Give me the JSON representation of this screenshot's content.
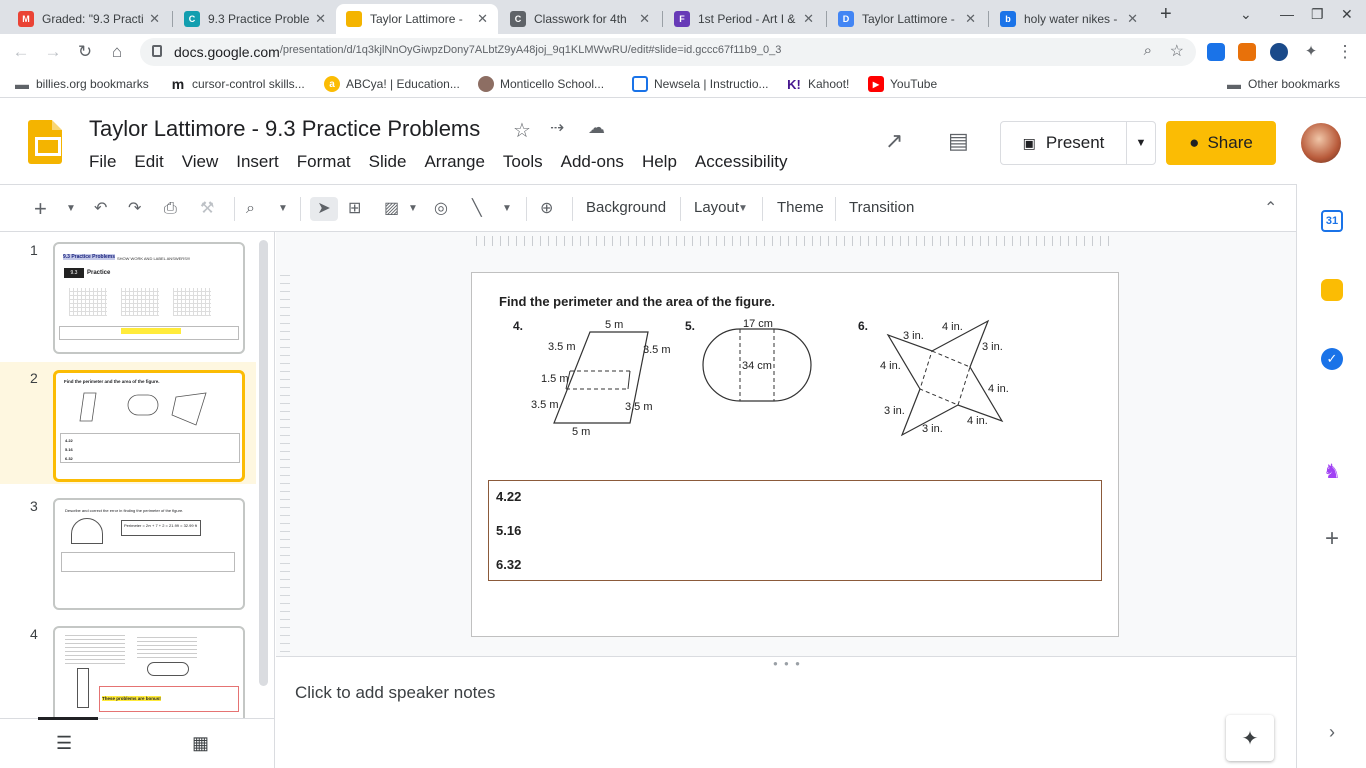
{
  "browser": {
    "tabs": [
      {
        "title": "Graded: \"9.3 Practice",
        "fav_color": "#ea4335",
        "fav_text": "M"
      },
      {
        "title": "9.3 Practice Proble",
        "fav_color": "#129eaf",
        "fav_text": "C"
      },
      {
        "title": "Taylor Lattimore -",
        "fav_color": "#f4b400",
        "fav_text": ""
      },
      {
        "title": "Classwork for 4th",
        "fav_color": "#5f6368",
        "fav_text": "C"
      },
      {
        "title": "1st Period - Art I &",
        "fav_color": "#673ab7",
        "fav_text": "F"
      },
      {
        "title": "Taylor Lattimore -",
        "fav_color": "#4285f4",
        "fav_text": "D"
      },
      {
        "title": "holy water nikes -",
        "fav_color": "#1a73e8",
        "fav_text": "b"
      }
    ],
    "url_host": "docs.google.com",
    "url_path": "/presentation/d/1q3kjlNnOyGiwpzDony7ALbtZ9yA48joj_9q1KLMWwRU/edit#slide=id.gccc67f11b9_0_3",
    "bookmarks": [
      {
        "label": "billies.org bookmarks",
        "icon": "folder-icon"
      },
      {
        "label": "cursor-control skills...",
        "icon": "m-logo-icon"
      },
      {
        "label": "ABCya! | Education...",
        "icon": "abcya-icon"
      },
      {
        "label": "Monticello School...",
        "icon": "school-icon"
      },
      {
        "label": "Newsela | Instructio...",
        "icon": "newsela-icon"
      },
      {
        "label": "Kahoot!",
        "icon": "kahoot-icon"
      },
      {
        "label": "YouTube",
        "icon": "youtube-icon"
      }
    ],
    "other_bookmarks": "Other bookmarks"
  },
  "app": {
    "doc_title": "Taylor Lattimore - 9.3 Practice Problems",
    "menu": [
      "File",
      "Edit",
      "View",
      "Insert",
      "Format",
      "Slide",
      "Arrange",
      "Tools",
      "Add-ons",
      "Help",
      "Accessibility"
    ],
    "present_label": "Present",
    "share_label": "Share",
    "toolbar": {
      "background": "Background",
      "layout": "Layout",
      "theme": "Theme",
      "transition": "Transition"
    },
    "brand_color": "#fbbc04"
  },
  "filmstrip": {
    "slides": [
      {
        "num": "1",
        "title": "9.3 Practice Problems",
        "note": "SHOW WORK AND LABEL ANSWERS!!!",
        "badge": "9.3",
        "sub": "Practice"
      },
      {
        "num": "2",
        "title": "Find the perimeter and the area of the figure.",
        "answers": [
          "4.22",
          "5.16",
          "6.32"
        ]
      },
      {
        "num": "3",
        "title": "Describe and correct the error in finding the perimeter of the figure.",
        "formula": "Perimeter = 2π + 7 + 2 = 21.99 = 32.99 ft"
      },
      {
        "num": "4",
        "title": "",
        "highlight": "These problems are bonus!"
      }
    ]
  },
  "slide": {
    "heading": "Find the perimeter and the area of the figure.",
    "figures": [
      {
        "num": "4.",
        "labels": [
          "5 m",
          "3.5 m",
          "3.5 m",
          "1.5 m",
          "3.5 m",
          "3.5 m",
          "5 m"
        ]
      },
      {
        "num": "5.",
        "labels": [
          "17 cm",
          "34 cm"
        ]
      },
      {
        "num": "6.",
        "labels": [
          "3 in.",
          "4 in.",
          "3 in.",
          "4 in.",
          "4 in.",
          "3 in.",
          "4 in.",
          "3 in."
        ]
      }
    ],
    "answers": [
      "4.22",
      "5.16",
      "6.32"
    ]
  },
  "notes": {
    "placeholder": "Click to add speaker notes"
  }
}
